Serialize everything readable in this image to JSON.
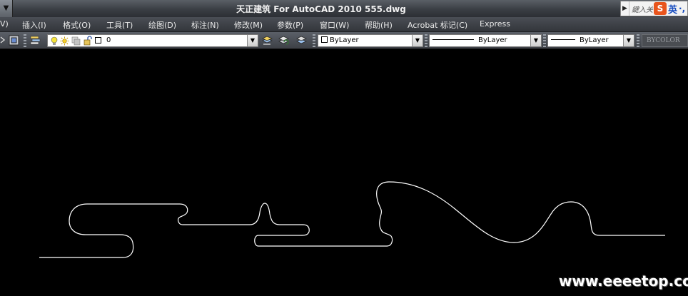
{
  "window": {
    "title": "天正建筑 For AutoCAD 2010     555.dwg",
    "sysmenu_glyph": "▼"
  },
  "ime": {
    "arrow": "▶",
    "input": "鍵入关",
    "logo": "S",
    "lang": "英",
    "punct": "·,"
  },
  "menu": [
    {
      "label": "V)"
    },
    {
      "label": "插入(I)"
    },
    {
      "label": "格式(O)"
    },
    {
      "label": "工具(T)"
    },
    {
      "label": "绘图(D)"
    },
    {
      "label": "标注(N)"
    },
    {
      "label": "修改(M)"
    },
    {
      "label": "参数(P)"
    },
    {
      "label": "窗口(W)"
    },
    {
      "label": "帮助(H)"
    },
    {
      "label": "Acrobat 标记(C)"
    },
    {
      "label": "Express"
    }
  ],
  "toolbar": {
    "layer_value": "0",
    "color_value": "ByLayer",
    "linetype_value": "ByLayer",
    "lineweight_value": "ByLayer",
    "plotstyle_value": "BYCOLOR"
  },
  "watermark": "www.eeeetop.com"
}
